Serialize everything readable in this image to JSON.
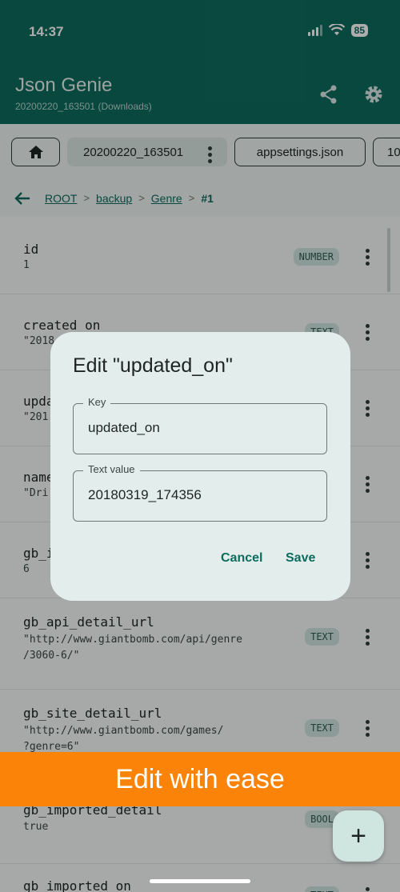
{
  "status_bar": {
    "time": "14:37",
    "battery": "85"
  },
  "appbar": {
    "title": "Json Genie",
    "subtitle": "20200220_163501 (Downloads)",
    "share_icon": "share-icon",
    "settings_icon": "gear-icon"
  },
  "tabs": {
    "home_icon": "home-icon",
    "items": [
      "20200220_163501",
      "appsettings.json",
      "10"
    ]
  },
  "breadcrumb": {
    "back_icon": "arrow-left-icon",
    "items": [
      "ROOT",
      "backup",
      "Genre"
    ],
    "current": "#1",
    "separator": ">"
  },
  "rows": [
    {
      "key": "id",
      "value": "1",
      "type": "NUMBER"
    },
    {
      "key": "created_on",
      "value": "\"2018",
      "type": "TEXT"
    },
    {
      "key": "upda",
      "value": "\"201",
      "type": ""
    },
    {
      "key": "name",
      "value": "\"Dri",
      "type": ""
    },
    {
      "key": "gb_i",
      "value": "6",
      "type": ""
    },
    {
      "key": "gb_api_detail_url",
      "value": "\"http://www.giantbomb.com/api/genre\n/3060-6/\"",
      "type": "TEXT"
    },
    {
      "key": "gb_site_detail_url",
      "value": "\"http://www.giantbomb.com/games/\n?genre=6\"",
      "type": "TEXT"
    },
    {
      "key": "gb_imported_detail",
      "value": "true",
      "type": "BOOL"
    },
    {
      "key": "gb_imported_on",
      "value": "",
      "type": "TEXT"
    }
  ],
  "dialog": {
    "title": "Edit \"updated_on\"",
    "key_label": "Key",
    "key_value": "updated_on",
    "text_label": "Text value",
    "text_value": "20180319_174356",
    "cancel": "Cancel",
    "save": "Save"
  },
  "banner": {
    "text": "Edit with ease"
  },
  "fab": {
    "label": "+"
  },
  "colors": {
    "primary": "#0d6b5e",
    "banner": "#fb8307",
    "badge": "#cfe5df"
  }
}
